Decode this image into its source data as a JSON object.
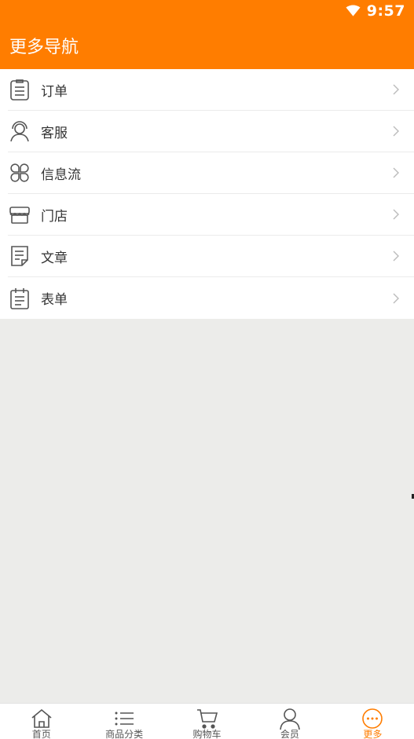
{
  "status_bar": {
    "time": "9:57"
  },
  "header": {
    "title": "更多导航"
  },
  "menu": [
    {
      "label": "订单",
      "icon": "clipboard-list-icon"
    },
    {
      "label": "客服",
      "icon": "headset-user-icon"
    },
    {
      "label": "信息流",
      "icon": "four-petal-icon"
    },
    {
      "label": "门店",
      "icon": "storefront-icon"
    },
    {
      "label": "文章",
      "icon": "document-icon"
    },
    {
      "label": "表单",
      "icon": "form-icon"
    }
  ],
  "tabbar": [
    {
      "label": "首页",
      "icon": "home-icon",
      "active": false
    },
    {
      "label": "商品分类",
      "icon": "category-list-icon",
      "active": false
    },
    {
      "label": "购物车",
      "icon": "cart-icon",
      "active": false
    },
    {
      "label": "会员",
      "icon": "user-icon",
      "active": false
    },
    {
      "label": "更多",
      "icon": "more-dots-icon",
      "active": true
    }
  ],
  "colors": {
    "accent": "#ff7d00",
    "background": "#ececea",
    "text": "#333333"
  }
}
